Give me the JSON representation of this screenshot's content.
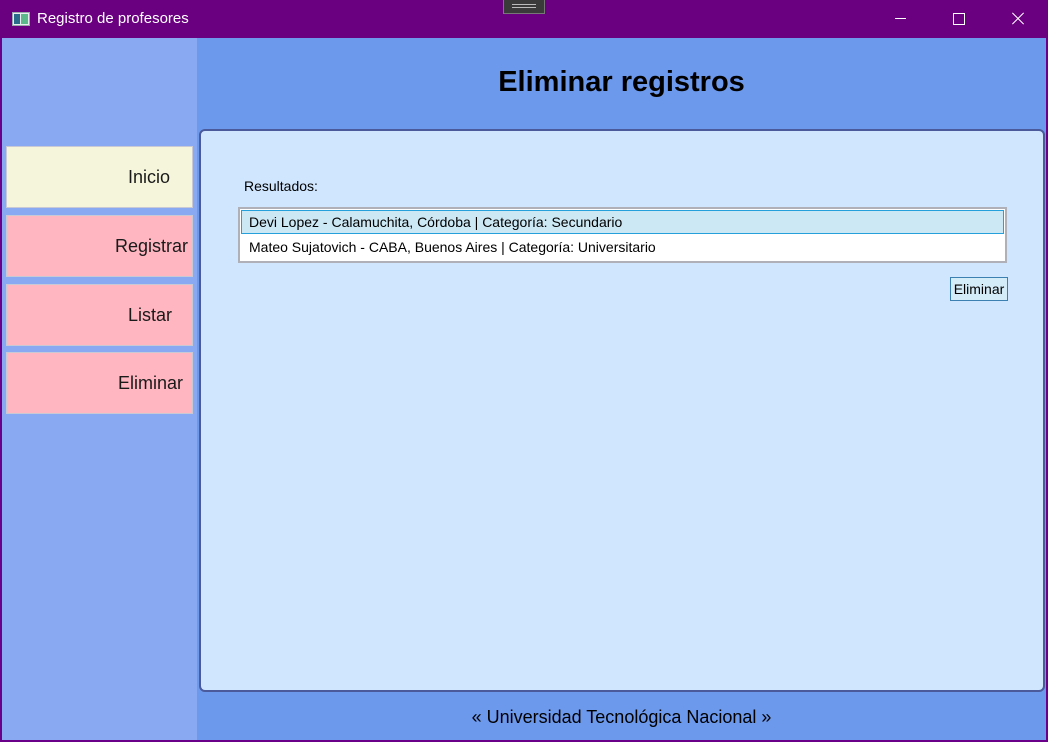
{
  "window": {
    "title": "Registro de profesores"
  },
  "sidebar": {
    "items": [
      {
        "label": "Inicio",
        "color": "#f5f5dc"
      },
      {
        "label": "Registrar",
        "color": "#ffb6c1"
      },
      {
        "label": "Listar",
        "color": "#ffb6c1"
      },
      {
        "label": "Eliminar",
        "color": "#ffb6c1"
      }
    ]
  },
  "main": {
    "title": "Eliminar registros",
    "results_label": "Resultados:",
    "results": [
      {
        "text": "Devi Lopez - Calamuchita, Córdoba | Categoría: Secundario",
        "selected": true
      },
      {
        "text": "Mateo Sujatovich - CABA, Buenos Aires | Categoría: Universitario",
        "selected": false
      }
    ],
    "delete_label": "Eliminar"
  },
  "footer": {
    "text": "« Universidad Tecnológica Nacional »"
  },
  "colors": {
    "titlebar": "#6a0080",
    "content_bg": "#6d99ed",
    "sidebar_bg": "#89aaf2",
    "panel_bg": "#d0e6fe",
    "selection": "#cce8f4"
  }
}
